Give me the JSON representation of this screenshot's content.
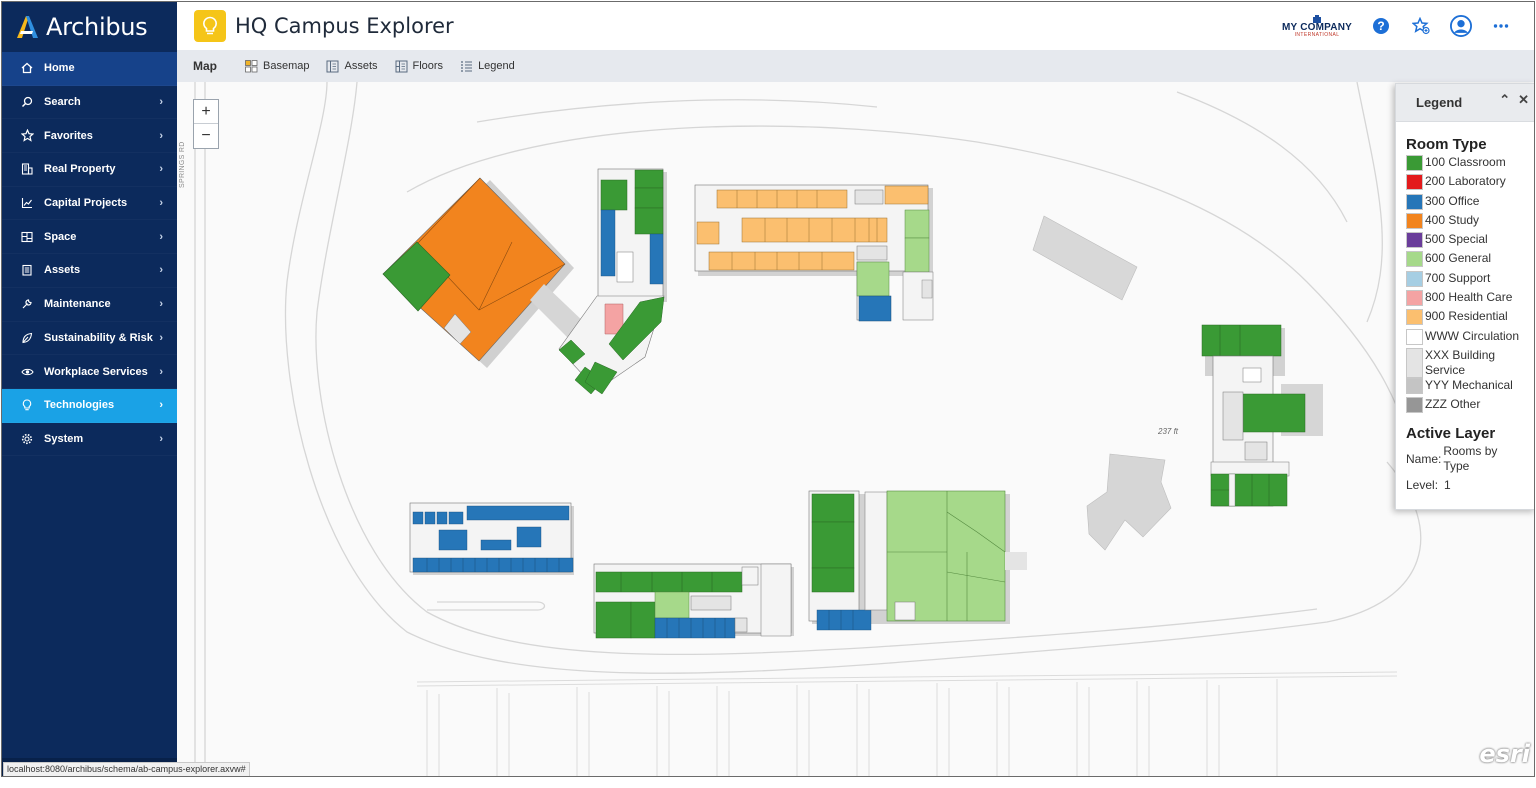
{
  "brand": {
    "name": "Archibus"
  },
  "app": {
    "title": "HQ Campus Explorer"
  },
  "company": {
    "name": "MY COMPANY",
    "sub": "INTERNATIONAL"
  },
  "sidebar": {
    "items": [
      {
        "label": "Home",
        "icon": "home-icon"
      },
      {
        "label": "Search",
        "icon": "search-icon"
      },
      {
        "label": "Favorites",
        "icon": "star-icon"
      },
      {
        "label": "Real Property",
        "icon": "building-icon"
      },
      {
        "label": "Capital Projects",
        "icon": "chart-icon"
      },
      {
        "label": "Space",
        "icon": "floorplan-icon"
      },
      {
        "label": "Assets",
        "icon": "clipboard-icon"
      },
      {
        "label": "Maintenance",
        "icon": "wrench-icon"
      },
      {
        "label": "Sustainability & Risk",
        "icon": "leaf-icon"
      },
      {
        "label": "Workplace Services",
        "icon": "eye-icon"
      },
      {
        "label": "Technologies",
        "icon": "lightbulb-icon"
      },
      {
        "label": "System",
        "icon": "gear-icon"
      }
    ],
    "active": "Technologies"
  },
  "toolbar": {
    "map_label": "Map",
    "basemap": "Basemap",
    "assets": "Assets",
    "floors": "Floors",
    "legend": "Legend"
  },
  "map": {
    "zoom_in": "+",
    "zoom_out": "−",
    "road_label": "SPRINGS RD",
    "scale_text": "237 ft",
    "attribution": "esri"
  },
  "legend": {
    "title": "Legend",
    "room_type_heading": "Room Type",
    "items": [
      {
        "label": "100 Classroom",
        "color": "#3a9a35"
      },
      {
        "label": "200 Laboratory",
        "color": "#e31a1c"
      },
      {
        "label": "300 Office",
        "color": "#2676b8"
      },
      {
        "label": "400 Study",
        "color": "#f2841e"
      },
      {
        "label": "500 Special",
        "color": "#6a3d9a"
      },
      {
        "label": "600 General",
        "color": "#a6d98a"
      },
      {
        "label": "700 Support",
        "color": "#a6cee3"
      },
      {
        "label": "800 Health Care",
        "color": "#f4a3a3"
      },
      {
        "label": "900 Residential",
        "color": "#fbbf6f"
      },
      {
        "label": "WWW Circulation",
        "color": "#ffffff"
      },
      {
        "label": "XXX Building Service",
        "color": "#e4e4e4"
      },
      {
        "label": "YYY Mechanical",
        "color": "#c4c4c4"
      },
      {
        "label": "ZZZ Other",
        "color": "#969696"
      }
    ],
    "active_layer_heading": "Active Layer",
    "name_key": "Name:",
    "name_value": "Rooms by Type",
    "level_key": "Level:",
    "level_value": "1"
  },
  "status": {
    "url": "localhost:8080/archibus/schema/ab-campus-explorer.axvw#"
  }
}
